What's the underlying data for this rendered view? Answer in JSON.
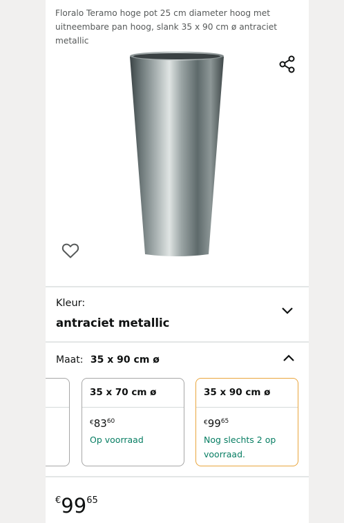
{
  "product": {
    "title": "Floralo Teramo hoge pot 25 cm diameter hoog met uitneembare pan hoog, slank 35 x 90 cm ø antraciet metallic"
  },
  "icons": {
    "share": "share-icon",
    "favorite": "heart-icon",
    "expand": "chevron-down-icon",
    "collapse": "chevron-up-icon"
  },
  "colour_selector": {
    "label": "Kleur:",
    "value": "antraciet metallic"
  },
  "size_selector": {
    "label": "Maat:",
    "value": "35 x 90 cm ø",
    "options": [
      {
        "size": "35 x 70 cm ø",
        "currency": "€",
        "price_whole": "83",
        "price_fraction": "60",
        "stock": "Op voorraad"
      },
      {
        "size": "35 x 90 cm ø",
        "currency": "€",
        "price_whole": "99",
        "price_fraction": "65",
        "stock": "Nog slechts 2 op voorraad.",
        "selected": true
      }
    ]
  },
  "price": {
    "currency": "€",
    "whole": "99",
    "fraction": "65"
  },
  "colors": {
    "selected_border": "#e9a53c",
    "in_stock": "#067d62"
  }
}
